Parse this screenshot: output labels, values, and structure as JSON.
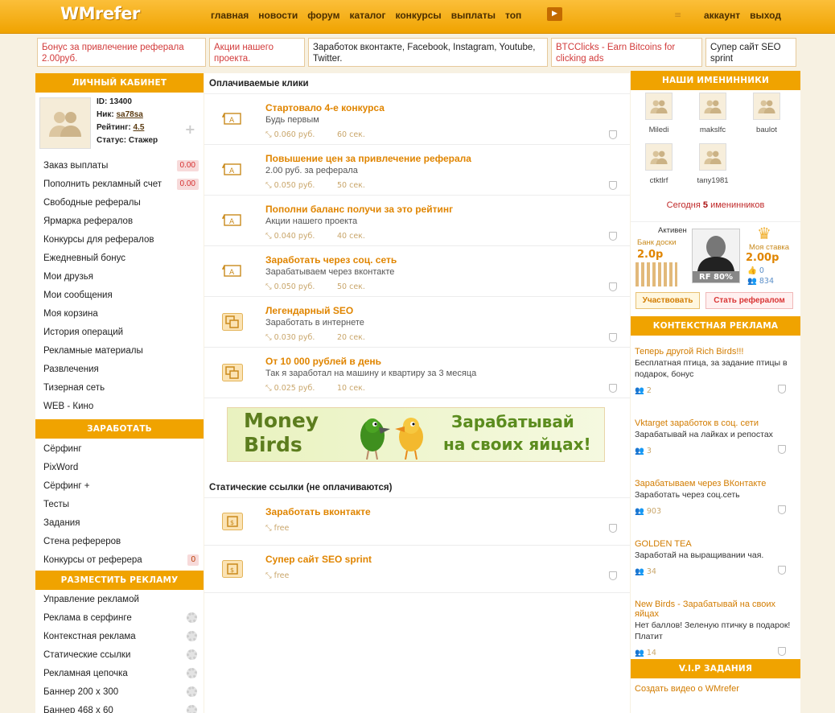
{
  "header": {
    "logo": "WMrefer",
    "nav": [
      "главная",
      "новости",
      "форум",
      "каталог",
      "конкурсы",
      "выплаты",
      "топ"
    ],
    "account": [
      "аккаунт",
      "выход"
    ]
  },
  "ads": [
    {
      "text": "Бонус за привлечение реферала 2.00руб."
    },
    {
      "text": "Акции нашего проекта."
    },
    {
      "text": "Заработок вконтакте, Facebook, Instagram, Youtube, Twitter."
    },
    {
      "text": "BTCClicks - Earn Bitcoins for clicking ads"
    },
    {
      "text": "Супер сайт SEO sprint"
    }
  ],
  "left": {
    "cabinet_title": "ЛИЧНЫЙ КАБИНЕТ",
    "profile": {
      "id_label": "ID:",
      "id": "13400",
      "nick_label": "Ник:",
      "nick": "sa78sa",
      "rating_label": "Рейтинг:",
      "rating": "4.5",
      "status_label": "Статус:",
      "status": "Стажер"
    },
    "cabinet_items": [
      {
        "label": "Заказ выплаты",
        "badge": "0.00"
      },
      {
        "label": "Пополнить рекламный счет",
        "badge": "0.00"
      },
      {
        "label": "Свободные рефералы"
      },
      {
        "label": "Ярмарка рефералов"
      },
      {
        "label": "Конкурсы для рефералов"
      },
      {
        "label": "Ежедневный бонус"
      },
      {
        "label": "Мои друзья"
      },
      {
        "label": "Мои сообщения"
      },
      {
        "label": "Моя корзина"
      },
      {
        "label": "История операций"
      },
      {
        "label": "Рекламные материалы"
      },
      {
        "label": "Развлечения"
      },
      {
        "label": "Тизерная сеть"
      },
      {
        "label": "WEB - Кино"
      }
    ],
    "earn_title": "ЗАРАБОТАТЬ",
    "earn_items": [
      {
        "label": "Сёрфинг"
      },
      {
        "label": "PixWord"
      },
      {
        "label": "Сёрфинг +"
      },
      {
        "label": "Тесты"
      },
      {
        "label": "Задания"
      },
      {
        "label": "Стена рефереров"
      },
      {
        "label": "Конкурсы от реферера",
        "badge": "0"
      }
    ],
    "ads_title": "РАЗМЕСТИТЬ РЕКЛАМУ",
    "ads_items": [
      {
        "label": "Управление рекламой"
      },
      {
        "label": "Реклама в серфинге"
      },
      {
        "label": "Контекстная реклама"
      },
      {
        "label": "Статические ссылки"
      },
      {
        "label": "Рекламная цепочка"
      },
      {
        "label": "Баннер 200 х 300"
      },
      {
        "label": "Баннер 468 х 60"
      }
    ]
  },
  "center": {
    "paid_title": "Оплачиваемые клики",
    "paid": [
      {
        "title": "Стартовало 4-е конкурса",
        "sub": "Будь первым",
        "price": "0.060 руб.",
        "sec": "60 сек.",
        "icon": "text-ad-icon"
      },
      {
        "title": "Повышение цен за привлечение реферала",
        "sub": "2.00 руб. за реферала",
        "price": "0.050 руб.",
        "sec": "50 сек.",
        "icon": "text-ad-icon"
      },
      {
        "title": "Пополни баланс получи за это рейтинг",
        "sub": "Акции нашего проекта",
        "price": "0.040 руб.",
        "sec": "40 сек.",
        "icon": "text-ad-icon"
      },
      {
        "title": "Заработать через соц. сеть",
        "sub": "Зарабатываем через вконтакте",
        "price": "0.050 руб.",
        "sec": "50 сек.",
        "icon": "text-ad-icon"
      },
      {
        "title": "Легендарный SEO",
        "sub": "Заработать в интернете",
        "price": "0.030 руб.",
        "sec": "20 сек.",
        "icon": "window-icon"
      },
      {
        "title": "От 10 000 рублей в день",
        "sub": "Так я заработал на машину и квартиру за 3 месяца",
        "price": "0.025 руб.",
        "sec": "10 сек.",
        "icon": "window-icon"
      }
    ],
    "banner": {
      "name1": "Money",
      "name2": "Birds",
      "line1": "Зарабатывай",
      "line2": "на своих яйцах!"
    },
    "static_title": "Статические ссылки (не оплачиваются)",
    "static": [
      {
        "title": "Заработать вконтакте",
        "price": "free"
      },
      {
        "title": "Супер сайт SEO sprint",
        "price": "free"
      }
    ]
  },
  "right": {
    "bday_title": "НАШИ ИМЕНИННИКИ",
    "bdays": [
      "Miledi",
      "makslfc",
      "baulot",
      "ctktlrf",
      "tany1981"
    ],
    "today_prefix": "Сегодня",
    "today_count": "5",
    "today_suffix": "именинников",
    "board": {
      "active": "Активен",
      "bank_label": "Банк доски",
      "bank": "2.0р",
      "rf": "RF 80%",
      "my_bet_label": "Моя ставка",
      "my_bet": "2.00р",
      "likes": "0",
      "users": "834",
      "participate": "Участвовать",
      "become_ref": "Стать рефералом"
    },
    "ctx_title": "КОНТЕКСТНАЯ РЕКЛАМА",
    "ctx": [
      {
        "title": "Теперь другой Rich Birds!!!",
        "desc": "Бесплатная птица, за задание птицы в подарок, бонус",
        "count": "2"
      },
      {
        "title": "Vktarget заработок в соц. сети",
        "desc": "Зарабатывай на лайках и репостах",
        "count": "3"
      },
      {
        "title": "Зарабатываем через ВКонтакте",
        "desc": "Заработать через соц.сеть",
        "count": "903"
      },
      {
        "title": "GOLDEN TEA",
        "desc": "Заработай на выращивании чая.",
        "count": "34"
      },
      {
        "title": "New Birds - Зарабатывай на своих яйцах",
        "desc": "Нет баллов! Зеленую птичку в подарок! Платит",
        "count": "14"
      }
    ],
    "vip_title": "V.I.P ЗАДАНИЯ",
    "vip_first": "Создать видео о WMrefer"
  },
  "colors": {
    "accent": "#f0a300",
    "link": "#e08500",
    "bg": "#f7f1e2"
  }
}
